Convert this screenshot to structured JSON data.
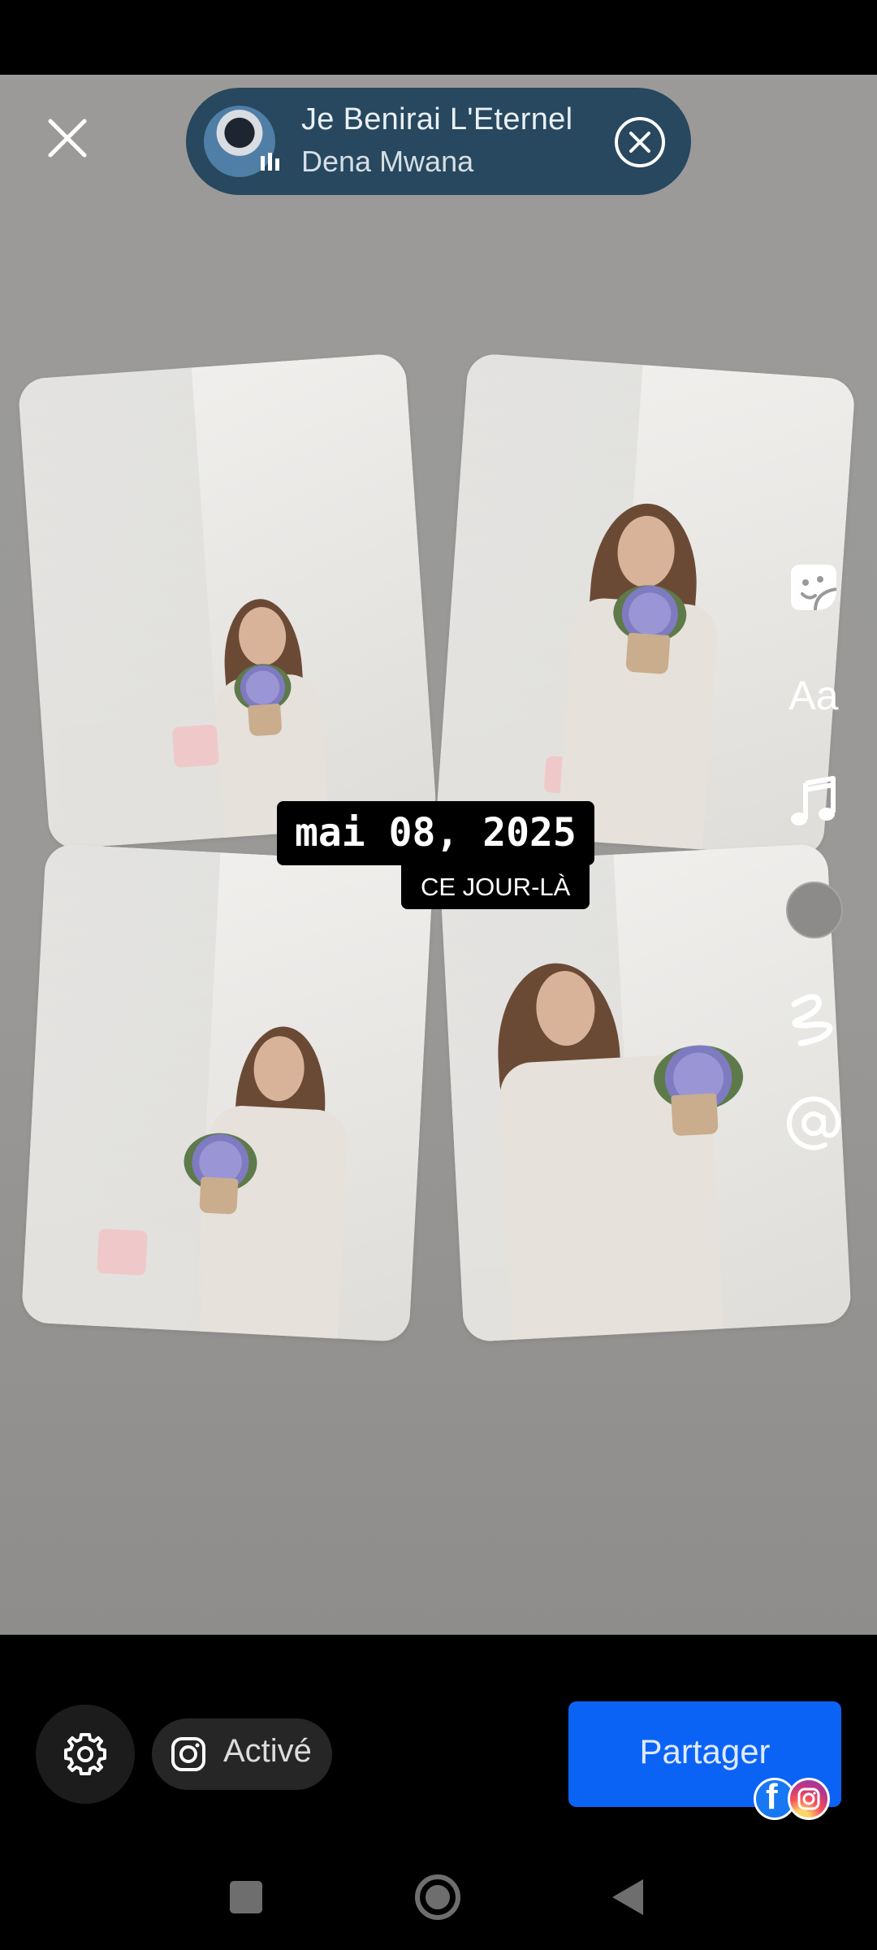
{
  "music": {
    "title": "Je Benirai L'Eternel",
    "artist": "Dena Mwana"
  },
  "date_sticker": {
    "date": "mai 08, 2025",
    "caption": "CE JOUR-LÀ"
  },
  "side_tools": {
    "text_label": "Aa",
    "icons": [
      "sticker-icon",
      "text-icon",
      "music-note-icon",
      "color-picker",
      "scribble-icon",
      "mention-icon"
    ],
    "color_swatch": "#8d8b89"
  },
  "bottom_bar": {
    "instagram_toggle_label": "Activé",
    "share_label": "Partager",
    "share_color": "#0b63f6"
  },
  "photos": [
    {
      "description": "photo-1"
    },
    {
      "description": "photo-2"
    },
    {
      "description": "photo-3"
    },
    {
      "description": "photo-4"
    }
  ]
}
